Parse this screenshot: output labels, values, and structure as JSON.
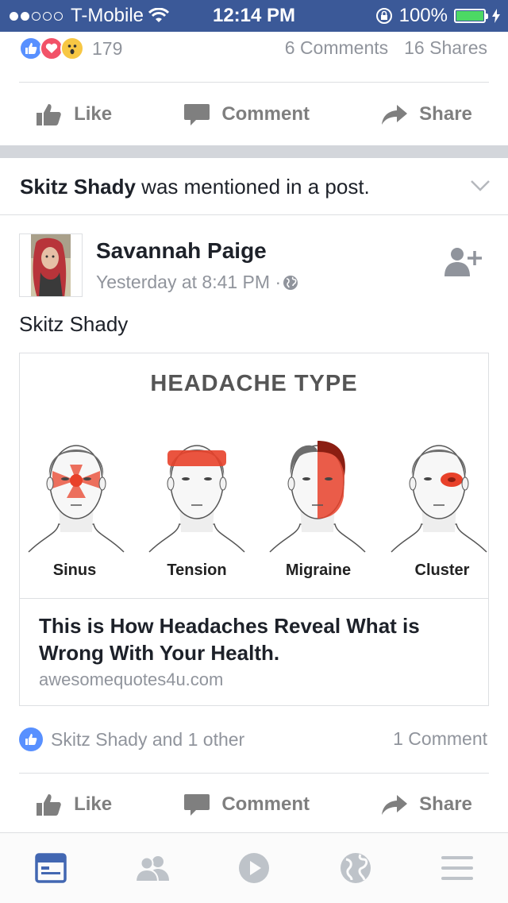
{
  "status_bar": {
    "carrier": "T-Mobile",
    "time": "12:14 PM",
    "battery": "100%"
  },
  "top_post": {
    "reaction_count": "179",
    "comments": "6 Comments",
    "shares": "16 Shares",
    "actions": {
      "like": "Like",
      "comment": "Comment",
      "share": "Share"
    }
  },
  "notification": {
    "name": "Skitz Shady",
    "text": " was mentioned in a post."
  },
  "post": {
    "author": "Savannah Paige",
    "timestamp": "Yesterday at 8:41 PM · ",
    "mention": "Skitz Shady",
    "link": {
      "image_title": "HEADACHE TYPE",
      "types": [
        "Sinus",
        "Tension",
        "Migraine",
        "Cluster"
      ],
      "title": "This is How Headaches Reveal What is Wrong With Your Health.",
      "domain": "awesomequotes4u.com"
    },
    "likes_text": "Skitz Shady and 1 other",
    "comments": "1 Comment",
    "actions": {
      "like": "Like",
      "comment": "Comment",
      "share": "Share"
    }
  },
  "tab_bar": {
    "icons": [
      "news-feed-icon",
      "friends-icon",
      "video-icon",
      "globe-icon",
      "menu-icon"
    ]
  },
  "colors": {
    "brand": "#3b5998",
    "like_blue": "#5890ff",
    "text_muted": "#90949c",
    "headache_red": "#e8412a"
  }
}
